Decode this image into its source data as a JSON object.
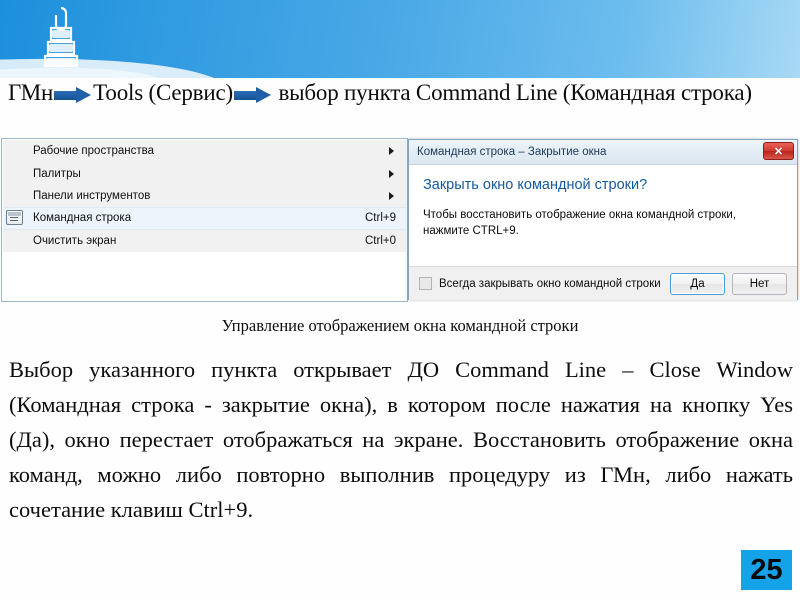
{
  "header": {
    "logo_icon": "stacked-paperclip-icon"
  },
  "title": {
    "part1": "ГМн",
    "part2": "Tools (Сервис)",
    "part3": "выбор пункта Command Line (Командная строка)"
  },
  "menu": {
    "items": [
      {
        "label": "Рабочие пространства",
        "accel": "",
        "has_submenu": true,
        "selected": false,
        "icon": ""
      },
      {
        "label": "Палитры",
        "accel": "",
        "has_submenu": true,
        "selected": false,
        "icon": ""
      },
      {
        "label": "Панели инструментов",
        "accel": "",
        "has_submenu": true,
        "selected": false,
        "icon": ""
      },
      {
        "label": "Командная строка",
        "accel": "Ctrl+9",
        "has_submenu": false,
        "selected": true,
        "icon": "command-line-icon"
      },
      {
        "label": "Очистить экран",
        "accel": "Ctrl+0",
        "has_submenu": false,
        "selected": false,
        "icon": ""
      }
    ]
  },
  "dialog": {
    "title": "Командная строка – Закрытие окна",
    "close_label": "✕",
    "heading": "Закрыть окно командной строки?",
    "text": "Чтобы восстановить отображение окна командной строки, нажмите CTRL+9.",
    "checkbox_label": "Всегда закрывать окно командной строки",
    "checkbox_checked": false,
    "yes_label": "Да",
    "no_label": "Нет"
  },
  "caption": "Управление отображением окна командной строки",
  "body_text": "Выбор указанного пункта открывает ДО Command Line – Close Window (Командная строка - закрытие окна), в котором после нажатия на кнопку Yes (Да), окно перестает отображаться на экране. Восстановить отображение окна команд, можно либо повторно выполнив процедуру из ГМн, либо нажать сочетание клавиш Ctrl+9.",
  "page_number": "25",
  "colors": {
    "header_blue": "#2e9ae0",
    "arrow_blue": "#1f5fa8",
    "dialog_heading_blue": "#13599e",
    "close_red": "#cf3b30",
    "page_badge_cyan": "#14a3e8"
  }
}
